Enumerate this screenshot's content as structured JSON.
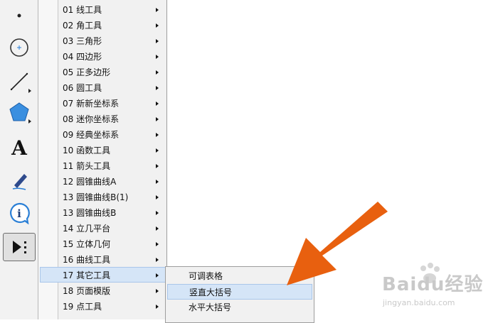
{
  "toolbar": {
    "tools": [
      {
        "icon": "point-icon"
      },
      {
        "icon": "circle-icon"
      },
      {
        "icon": "line-segment-icon"
      },
      {
        "icon": "polygon-icon"
      },
      {
        "icon": "text-icon",
        "label": "A"
      },
      {
        "icon": "marker-pen-icon"
      },
      {
        "icon": "info-icon",
        "label": "i"
      },
      {
        "icon": "custom-tools-icon",
        "active": true
      }
    ]
  },
  "menu": {
    "items": [
      {
        "label": "01 线工具"
      },
      {
        "label": "02 角工具"
      },
      {
        "label": "03 三角形"
      },
      {
        "label": "04 四边形"
      },
      {
        "label": "05 正多边形"
      },
      {
        "label": "06 圆工具"
      },
      {
        "label": "07 新新坐标系"
      },
      {
        "label": "08 迷你坐标系"
      },
      {
        "label": "09 经典坐标系"
      },
      {
        "label": "10 函数工具"
      },
      {
        "label": "11 箭头工具"
      },
      {
        "label": "12 圆锥曲线A"
      },
      {
        "label": "13 圆锥曲线B(1)"
      },
      {
        "label": "13 圆锥曲线B"
      },
      {
        "label": "14 立几平台"
      },
      {
        "label": "15 立体几何"
      },
      {
        "label": "16 曲线工具"
      },
      {
        "label": "17 其它工具",
        "highlighted": true
      },
      {
        "label": "18 页面模版"
      },
      {
        "label": "19 点工具"
      }
    ]
  },
  "submenu": {
    "items": [
      {
        "label": "可调表格"
      },
      {
        "label": "竖直大括号",
        "highlighted": true
      },
      {
        "label": "水平大括号"
      }
    ]
  },
  "annotation": {
    "arrow_color": "#e8600f"
  },
  "watermark": {
    "main": "Baidu经验",
    "sub": "jingyan.baidu.com"
  },
  "colors": {
    "highlight": "#d5e5f7",
    "menu_bg": "#f1f1f1"
  }
}
